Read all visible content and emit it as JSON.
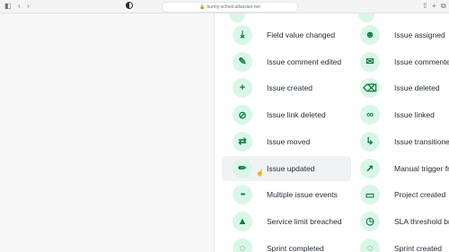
{
  "browser": {
    "url": "bunny-school.atlassian.net",
    "controls": [
      "◧",
      "‹",
      "›"
    ],
    "right_controls": [
      "⇧",
      "+",
      "⧉"
    ]
  },
  "triggers": {
    "left_column": [
      {
        "label": "Field value changed",
        "icon": "download-icon",
        "glyph": "⤓"
      },
      {
        "label": "Issue comment edited",
        "icon": "comment-edit-icon",
        "glyph": "✎"
      },
      {
        "label": "Issue created",
        "icon": "plus-icon",
        "glyph": "+"
      },
      {
        "label": "Issue link deleted",
        "icon": "link-broken-icon",
        "glyph": "⊘"
      },
      {
        "label": "Issue moved",
        "icon": "arrows-icon",
        "glyph": "⇄"
      },
      {
        "label": "Issue updated",
        "icon": "pencil-icon",
        "glyph": "✏"
      },
      {
        "label": "Multiple issue events",
        "icon": "dots-icon",
        "glyph": "•••"
      },
      {
        "label": "Service limit breached",
        "icon": "warning-icon",
        "glyph": "▲"
      },
      {
        "label": "Sprint completed",
        "icon": "sprint-icon",
        "glyph": "◌"
      }
    ],
    "right_column": [
      {
        "label": "Issue assigned",
        "icon": "person-icon",
        "glyph": "☻"
      },
      {
        "label": "Issue commented",
        "icon": "comment-icon",
        "glyph": "✉"
      },
      {
        "label": "Issue deleted",
        "icon": "trash-icon",
        "glyph": "⌫"
      },
      {
        "label": "Issue linked",
        "icon": "link-icon",
        "glyph": "∞"
      },
      {
        "label": "Issue transitioned",
        "icon": "transition-icon",
        "glyph": "↳"
      },
      {
        "label": "Manual trigger from iss",
        "icon": "cursor-click-icon",
        "glyph": "➚"
      },
      {
        "label": "Project created",
        "icon": "folder-icon",
        "glyph": "▭"
      },
      {
        "label": "SLA threshold breache",
        "icon": "clock-icon",
        "glyph": "◷"
      },
      {
        "label": "Sprint created",
        "icon": "sprint-icon",
        "glyph": "◌"
      }
    ]
  },
  "hovered_item": "Issue updated"
}
